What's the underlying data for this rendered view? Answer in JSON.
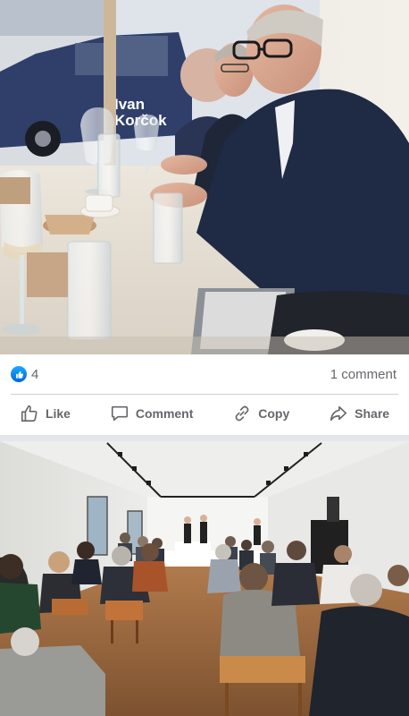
{
  "post": {
    "reactions": {
      "icon": "like-icon",
      "count": "4"
    },
    "comments_label": "1 comment",
    "actions": {
      "like_label": "Like",
      "comment_label": "Comment",
      "copy_label": "Copy",
      "share_label": "Share"
    }
  },
  "photo_top": {
    "banner_text": "Ivan Korčok"
  },
  "colors": {
    "accent": "#0866ff",
    "muted_text": "#65676b",
    "divider": "#ced0d4"
  }
}
